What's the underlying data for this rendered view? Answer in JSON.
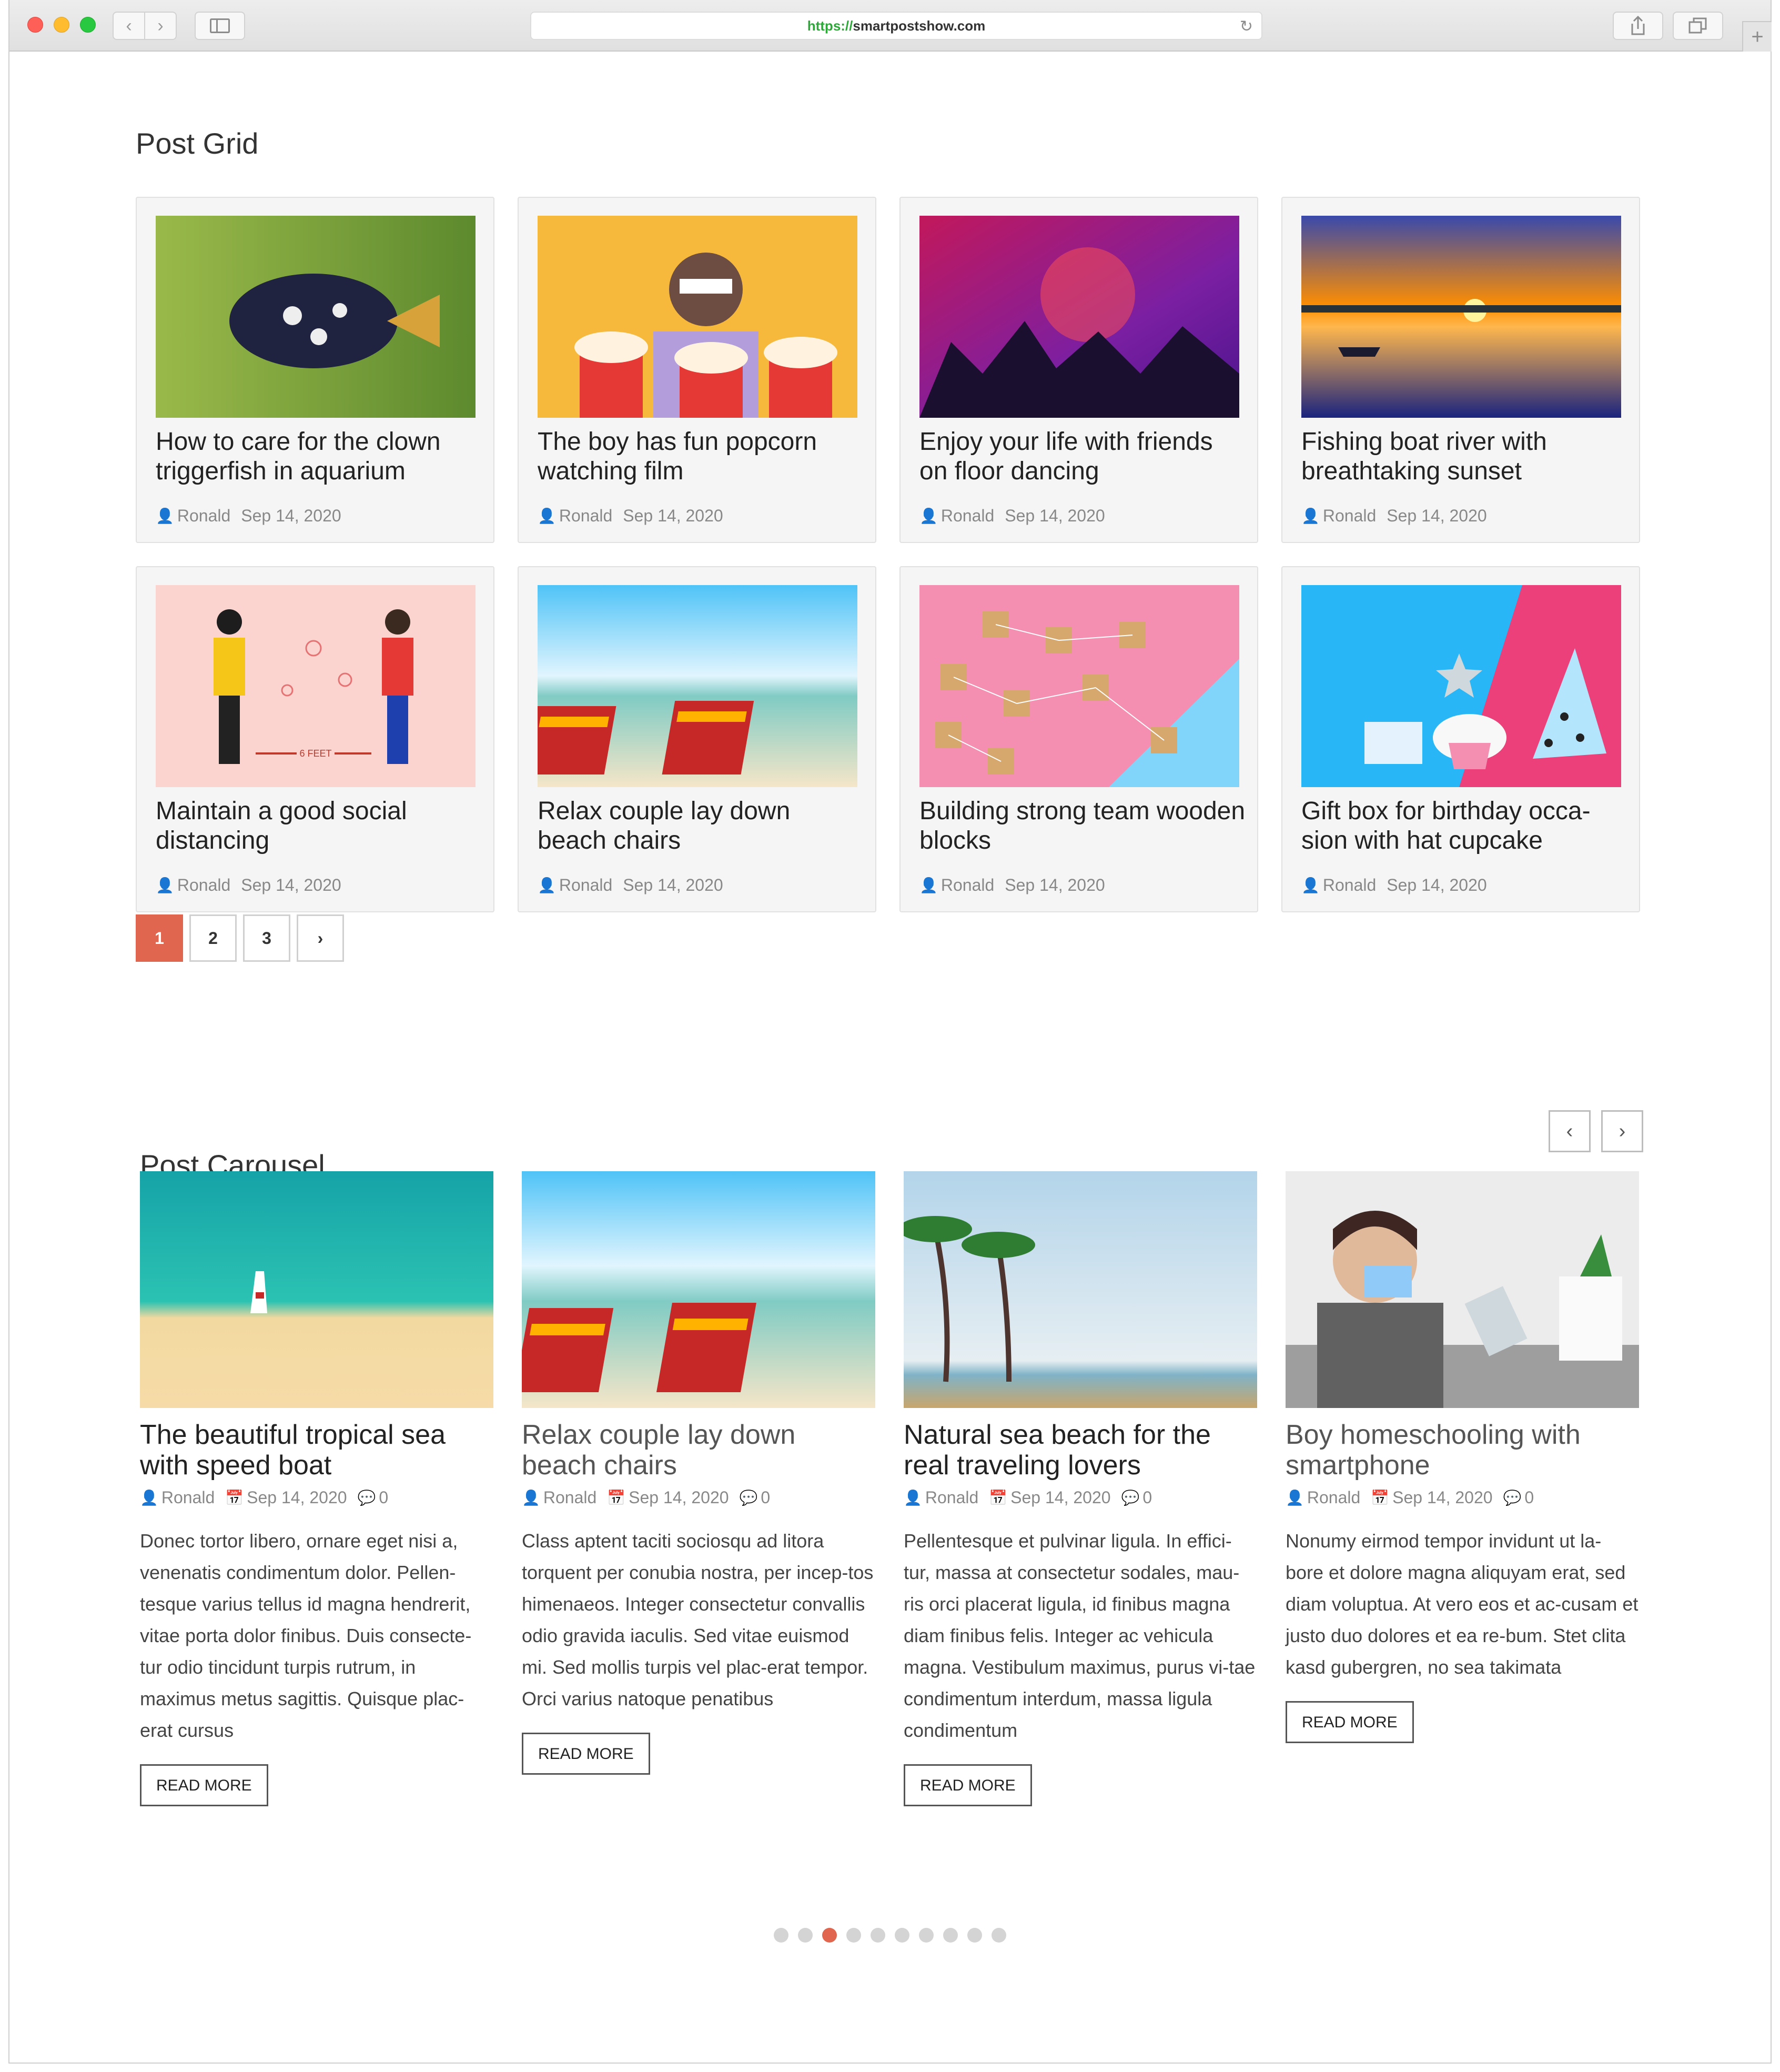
{
  "browser": {
    "url_scheme": "https://",
    "url_host": "smartpostshow.com"
  },
  "icons": {
    "back": "chevron-left-icon",
    "forward": "chevron-right-icon",
    "sidebar": "sidebar-icon",
    "reload": "reload-icon",
    "share": "share-icon",
    "tabs": "tabs-icon",
    "new_tab": "plus-icon",
    "author": "user-icon",
    "date": "calendar-icon",
    "comments": "comment-icon"
  },
  "colors": {
    "accent": "#e0664f"
  },
  "grid": {
    "title": "Post Grid",
    "posts": [
      {
        "title": "How to care for the clown triggerfish in aquarium",
        "author": "Ronald",
        "date": "Sep 14, 2020"
      },
      {
        "title": "The boy has fun popcorn watching film",
        "author": "Ronald",
        "date": "Sep 14, 2020"
      },
      {
        "title": "Enjoy your life with friends on floor dancing",
        "author": "Ronald",
        "date": "Sep 14, 2020"
      },
      {
        "title": "Fishing boat river with breathtaking sunset",
        "author": "Ronald",
        "date": "Sep 14, 2020"
      },
      {
        "title": "Maintain a good social distancing",
        "author": "Ronald",
        "date": "Sep 14, 2020"
      },
      {
        "title": "Relax couple lay down beach chairs",
        "author": "Ronald",
        "date": "Sep 14, 2020"
      },
      {
        "title": "Building strong team wooden blocks",
        "author": "Ronald",
        "date": "Sep 14, 2020"
      },
      {
        "title": "Gift box for birthday occa-sion with hat cupcake",
        "author": "Ronald",
        "date": "Sep 14, 2020"
      }
    ],
    "image_text": {
      "distance_label": "6 FEET"
    },
    "pagination": {
      "pages": [
        "1",
        "2",
        "3"
      ],
      "current": "1",
      "next": "›"
    }
  },
  "carousel": {
    "title": "Post Carousel",
    "prev": "‹",
    "next": "›",
    "posts": [
      {
        "title": "The beautiful tropical sea with speed boat",
        "author": "Ronald",
        "date": "Sep 14, 2020",
        "comments": "0",
        "excerpt": "Donec tortor libero, ornare eget nisi a, venenatis condimentum dolor. Pellen-tesque varius tellus id magna hendrerit, vitae porta dolor finibus. Duis consecte-tur odio tincidunt turpis rutrum, in maximus metus sagittis. Quisque plac-erat cursus",
        "read_more": "READ MORE"
      },
      {
        "title": "Relax couple lay down beach chairs",
        "author": "Ronald",
        "date": "Sep 14, 2020",
        "comments": "0",
        "excerpt": "Class aptent taciti sociosqu ad litora torquent per conubia nostra, per incep-tos himenaeos. Integer consectetur convallis odio gravida iaculis. Sed vitae euismod mi. Sed mollis turpis vel plac-erat tempor. Orci varius natoque penatibus",
        "read_more": "READ MORE"
      },
      {
        "title": "Natural sea beach for the real traveling lovers",
        "author": "Ronald",
        "date": "Sep 14, 2020",
        "comments": "0",
        "excerpt": "Pellentesque et pulvinar ligula. In effici-tur, massa at consectetur sodales, mau-ris orci placerat ligula, id finibus magna diam finibus felis. Integer ac vehicula magna. Vestibulum maximus, purus vi-tae condimentum interdum, massa ligula condimentum",
        "read_more": "READ MORE"
      },
      {
        "title": "Boy homeschooling with smartphone",
        "author": "Ronald",
        "date": "Sep 14, 2020",
        "comments": "0",
        "excerpt": "Nonumy eirmod tempor invidunt ut la-bore et dolore magna aliquyam erat, sed diam voluptua. At vero eos et ac-cusam et justo duo dolores et ea re-bum. Stet clita kasd gubergren, no sea takimata",
        "read_more": "READ MORE"
      }
    ],
    "dot_count": 10,
    "active_dot": 3
  }
}
